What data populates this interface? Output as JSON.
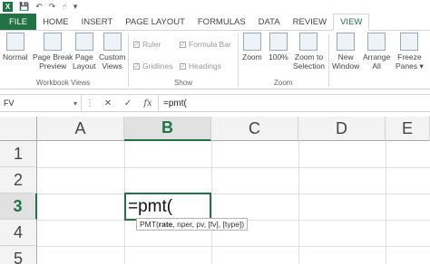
{
  "qat": {
    "logo": "X"
  },
  "tabs": [
    "FILE",
    "HOME",
    "INSERT",
    "PAGE LAYOUT",
    "FORMULAS",
    "DATA",
    "REVIEW",
    "VIEW"
  ],
  "ribbon": {
    "workbook_views": {
      "label": "Workbook Views",
      "buttons": [
        {
          "line1": "Normal",
          "line2": ""
        },
        {
          "line1": "Page Break",
          "line2": "Preview"
        },
        {
          "line1": "Page",
          "line2": "Layout"
        },
        {
          "line1": "Custom",
          "line2": "Views"
        }
      ]
    },
    "show": {
      "label": "Show",
      "checks": [
        {
          "text": "Ruler",
          "mark": "✓"
        },
        {
          "text": "Formula Bar",
          "mark": "✓"
        },
        {
          "text": "Gridlines",
          "mark": "✓"
        },
        {
          "text": "Headings",
          "mark": "✓"
        }
      ]
    },
    "zoom": {
      "label": "Zoom",
      "buttons": [
        {
          "line1": "Zoom",
          "line2": ""
        },
        {
          "line1": "100%",
          "line2": ""
        },
        {
          "line1": "Zoom to",
          "line2": "Selection"
        }
      ]
    },
    "window": {
      "buttons": [
        {
          "line1": "New",
          "line2": "Window"
        },
        {
          "line1": "Arrange",
          "line2": "All"
        },
        {
          "line1": "Freeze",
          "line2": "Panes ▾"
        }
      ]
    }
  },
  "formula_bar": {
    "name_box": "FV",
    "cancel": "✕",
    "enter": "✓",
    "fx": "fx",
    "content": "=pmt("
  },
  "sheet": {
    "columns": [
      "A",
      "B",
      "C",
      "D",
      "E"
    ],
    "selected_column": "B",
    "rows": [
      "1",
      "2",
      "3",
      "4",
      "5"
    ],
    "selected_row": "3",
    "active_cell_value": "=pmt(",
    "tooltip": {
      "func": "PMT(",
      "current_arg": "rate",
      "rest": ", nper, pv, [fv], [type])"
    }
  }
}
